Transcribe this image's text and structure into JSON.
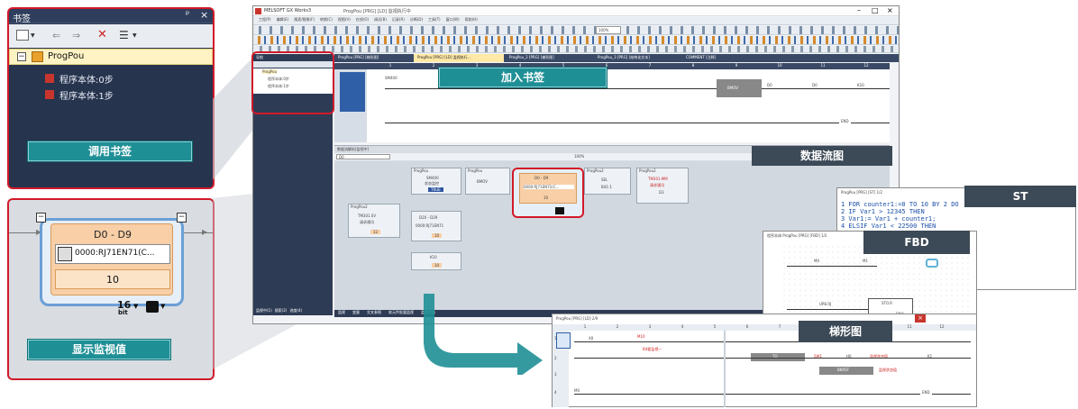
{
  "bookmark_panel": {
    "title": "书签",
    "pin_icon": "pin-icon",
    "close_icon": "close-icon",
    "tree_root": "ProgPou",
    "tree_items": [
      "程序本体:0步",
      "程序本体:1步"
    ],
    "action_label": "调用书签"
  },
  "monitor_panel": {
    "range": "D0 - D9",
    "module": "0000:RJ71EN71(C...",
    "value": "10",
    "format_bits": "16",
    "format_unit": "bit",
    "action_label": "显示监视值"
  },
  "main_window": {
    "title": "MELSOFT GX Works3",
    "title_suffix": "ProgPou [PRG] [LD] 监视执行中",
    "controls": [
      "–",
      "□",
      "×"
    ],
    "menu": [
      "工程(P)",
      "编辑(E)",
      "搜索/替换(F)",
      "转换(C)",
      "视图(V)",
      "在线(O)",
      "调试(B)",
      "记录(R)",
      "诊断(D)",
      "工具(T)",
      "窗口(W)",
      "帮助(H)"
    ],
    "zoom": "100%",
    "tabs": [
      "ProgPou [PRG] [梯形图]",
      "ProgPou [PRG] [LD] 监视执行...",
      "ProgPou_2 [PRG] [梯形图]",
      "ProgPou_3 [PRG] [结构化文本]",
      "COMMENT [注释]"
    ],
    "nav_title": "导航",
    "nav_items": [
      "ProgPou",
      "程序本体:0步",
      "程序本体:1步"
    ],
    "ladder_headers": [
      "1",
      "2",
      "3",
      "4",
      "5",
      "6",
      "7",
      "8",
      "9",
      "10",
      "11",
      "12"
    ],
    "ladder_contacts": [
      "SM400",
      "D0",
      "D0",
      "K10"
    ],
    "ladder_bmov": "BMOV",
    "ladder_end": "END",
    "status_left": [
      "监视中(1)",
      "搜索(2)",
      "进度(4)"
    ],
    "status_bottom": [
      "监视",
      "变量",
      "交叉参照",
      "软元件批量监视",
      "监视状态"
    ],
    "flow_title": "数据流解析[监视中]",
    "flow_selector": "D0",
    "flow_zoom": "100%",
    "flow_blocks": [
      {
        "name": "ProgPou",
        "lines": [
          "SM400",
          "状态监控",
          "TRUE"
        ]
      },
      {
        "name": "ProgPou",
        "lines": [
          "BMOV"
        ]
      },
      {
        "name": "ProgPou",
        "lines": [
          "D0 - D9",
          "0000:RJ71EN71(C...",
          "10"
        ]
      },
      {
        "name": "ProgPou2",
        "lines": [
          "SEL",
          "Bit1:1"
        ]
      },
      {
        "name": "ProgPou2",
        "lines": [
          "TM301.MM",
          "请求通讯",
          "D3"
        ]
      },
      {
        "name": "ProgPou2",
        "lines": [
          "TM301.SV",
          "请求通讯",
          "12"
        ]
      },
      {
        "name": "",
        "lines": [
          "D20 - D29",
          "0000:RJ71EN71",
          "10"
        ]
      },
      {
        "name": "",
        "lines": [
          "K10",
          "10"
        ]
      }
    ]
  },
  "callouts": {
    "add_bookmark": "加入书签",
    "data_flow": "数据流图",
    "st": "ST",
    "fbd": "FBD",
    "ladder": "梯形图"
  },
  "st_window": {
    "title": "ProgPou [PRG] [ST] 1/2",
    "lines": [
      "1  FOR counter1:=0 TO 10 BY 2 DO",
      "2    IF Var1 > 12345 THEN",
      "3      Var1:= Var1 + counter1;",
      "4    ELSIF Var1 < 22500 THEN"
    ]
  },
  "fbd_window": {
    "title": "程序本体:ProgPou [PRG] [FBD] 1/2",
    "labels": [
      "M0",
      "M1",
      "UPB.RJ",
      "STO.R",
      "ENO",
      "M10"
    ]
  },
  "ladder_window": {
    "title": "ProgPou [PRG] [LD] 2/9",
    "close": "×",
    "col_headers": [
      "1",
      "2",
      "3",
      "4",
      "5",
      "6",
      "7",
      "8",
      "9",
      "10",
      "11",
      "12"
    ],
    "row_numbers": [
      "1",
      "2",
      "3",
      "4"
    ],
    "cells": [
      "X0",
      "M10",
      "Bit要监视一",
      "TO",
      "SW1",
      "H0",
      "监视状态值",
      "K1",
      "BKRST",
      "监视状态值",
      "M0",
      "END"
    ]
  },
  "colors": {
    "accent_teal": "#1f8f96",
    "frame_red": "#d11a2a",
    "dark_label": "#3c4956",
    "panel_navy": "#2e3b55",
    "block_orange": "#f8cfa6"
  }
}
